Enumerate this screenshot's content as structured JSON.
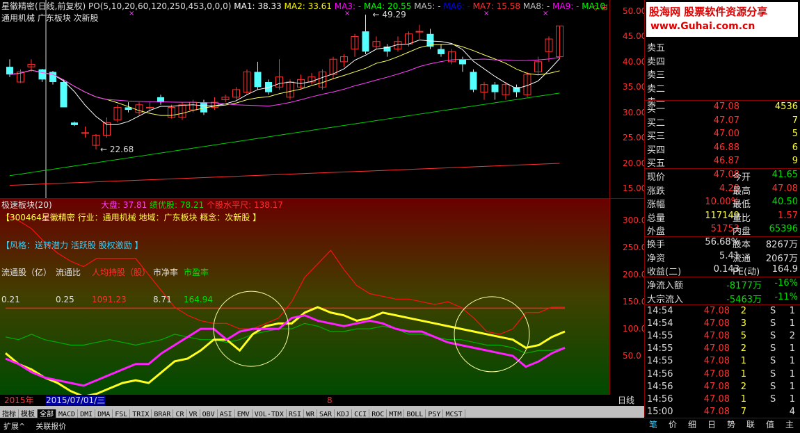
{
  "header": {
    "title": "星徽精密(日线,前复权)",
    "po": "PO(5,10,20,60,120,250,453,0,0,0)",
    "ma": [
      {
        "label": "MA1: 38.33",
        "color": "#ffffff"
      },
      {
        "label": "MA2: 33.61",
        "color": "#ffff00"
      },
      {
        "label": "MA3: -",
        "color": "#ff00ff"
      },
      {
        "label": "MA4: 20.55",
        "color": "#00ff00"
      },
      {
        "label": "MA5: -",
        "color": "#c0c0c0"
      },
      {
        "label": "MA6: -",
        "color": "#0000ff"
      },
      {
        "label": "MA7: 15.58",
        "color": "#ff3030"
      },
      {
        "label": "MA8: -",
        "color": "#c0c0c0"
      },
      {
        "label": "MA9: -",
        "color": "#ff00ff"
      },
      {
        "label": "MA10: -",
        "color": "#00ff00"
      }
    ],
    "subtitle": "通用机械 广东板块 次新股"
  },
  "main_chart": {
    "price_axis": [
      "50.00",
      "45.00",
      "40.00",
      "35.00",
      "30.00",
      "25.00",
      "20.00",
      "15.00"
    ],
    "high_label": "49.29",
    "low_label": "22.68",
    "candles": [
      {
        "o": 39.0,
        "c": 37.5,
        "h": 40.5,
        "l": 37.0
      },
      {
        "o": 36.0,
        "c": 38.0,
        "h": 38.5,
        "l": 35.8
      },
      {
        "o": 39.0,
        "c": 39.5,
        "h": 40.5,
        "l": 38.0
      },
      {
        "o": 38.5,
        "c": 36.5,
        "h": 38.6,
        "l": 36.0
      },
      {
        "o": 38.0,
        "c": 36.0,
        "h": 38.2,
        "l": 35.5
      },
      {
        "o": 36.0,
        "c": 31.0,
        "h": 36.5,
        "l": 31.0
      },
      {
        "o": 28.0,
        "c": 27.5,
        "h": 28.2,
        "l": 27.3
      },
      {
        "o": 26.0,
        "c": 26.0,
        "h": 27.2,
        "l": 25.0
      },
      {
        "o": 23.5,
        "c": 25.5,
        "h": 25.7,
        "l": 22.68
      },
      {
        "o": 25.5,
        "c": 28.0,
        "h": 29.0,
        "l": 25.0
      },
      {
        "o": 28.5,
        "c": 31.0,
        "h": 31.5,
        "l": 28.0
      },
      {
        "o": 31.0,
        "c": 30.5,
        "h": 32.0,
        "l": 30.0
      },
      {
        "o": 30.0,
        "c": 31.5,
        "h": 32.0,
        "l": 29.5
      },
      {
        "o": 31.0,
        "c": 31.0,
        "h": 32.0,
        "l": 30.0
      },
      {
        "o": 33.0,
        "c": 32.0,
        "h": 33.5,
        "l": 31.5
      },
      {
        "o": 29.0,
        "c": 31.0,
        "h": 31.5,
        "l": 28.8
      },
      {
        "o": 29.0,
        "c": 31.5,
        "h": 32.0,
        "l": 28.5
      },
      {
        "o": 30.5,
        "c": 32.0,
        "h": 32.5,
        "l": 30.0
      },
      {
        "o": 32.0,
        "c": 30.0,
        "h": 32.5,
        "l": 29.5
      },
      {
        "o": 31.0,
        "c": 32.0,
        "h": 33.0,
        "l": 30.5
      },
      {
        "o": 32.5,
        "c": 33.0,
        "h": 33.5,
        "l": 32.0
      },
      {
        "o": 33.0,
        "c": 34.5,
        "h": 35.0,
        "l": 32.5
      },
      {
        "o": 34.0,
        "c": 38.0,
        "h": 38.5,
        "l": 33.5
      },
      {
        "o": 38.0,
        "c": 35.0,
        "h": 40.0,
        "l": 34.5
      },
      {
        "o": 36.0,
        "c": 34.0,
        "h": 36.5,
        "l": 33.5
      },
      {
        "o": 35.0,
        "c": 37.0,
        "h": 40.5,
        "l": 34.5
      },
      {
        "o": 33.0,
        "c": 36.0,
        "h": 36.5,
        "l": 32.5
      },
      {
        "o": 35.0,
        "c": 36.5,
        "h": 37.5,
        "l": 34.5
      },
      {
        "o": 36.0,
        "c": 37.0,
        "h": 37.8,
        "l": 35.5
      },
      {
        "o": 35.0,
        "c": 38.0,
        "h": 38.5,
        "l": 34.5
      },
      {
        "o": 37.5,
        "c": 40.5,
        "h": 41.0,
        "l": 36.5
      },
      {
        "o": 40.0,
        "c": 41.0,
        "h": 41.5,
        "l": 39.0
      },
      {
        "o": 42.5,
        "c": 45.0,
        "h": 45.5,
        "l": 41.0
      },
      {
        "o": 46.0,
        "c": 42.0,
        "h": 49.29,
        "l": 41.5
      },
      {
        "o": 43.0,
        "c": 44.0,
        "h": 45.0,
        "l": 42.5
      },
      {
        "o": 43.0,
        "c": 42.0,
        "h": 43.5,
        "l": 41.0
      },
      {
        "o": 42.5,
        "c": 44.0,
        "h": 45.0,
        "l": 42.0
      },
      {
        "o": 43.5,
        "c": 45.5,
        "h": 46.0,
        "l": 43.0
      },
      {
        "o": 46.0,
        "c": 46.0,
        "h": 47.3,
        "l": 44.5
      },
      {
        "o": 45.5,
        "c": 43.0,
        "h": 46.5,
        "l": 42.5
      },
      {
        "o": 42.5,
        "c": 41.5,
        "h": 43.5,
        "l": 41.0
      },
      {
        "o": 40.0,
        "c": 42.0,
        "h": 42.5,
        "l": 39.5
      },
      {
        "o": 40.5,
        "c": 39.5,
        "h": 41.0,
        "l": 38.0
      },
      {
        "o": 38.0,
        "c": 34.5,
        "h": 38.5,
        "l": 34.0
      },
      {
        "o": 34.0,
        "c": 35.5,
        "h": 36.0,
        "l": 32.5
      },
      {
        "o": 35.5,
        "c": 34.0,
        "h": 36.0,
        "l": 32.5
      },
      {
        "o": 33.5,
        "c": 35.5,
        "h": 36.0,
        "l": 32.5
      },
      {
        "o": 35.0,
        "c": 34.0,
        "h": 35.5,
        "l": 33.0
      },
      {
        "o": 33.5,
        "c": 37.5,
        "h": 38.0,
        "l": 33.0
      },
      {
        "o": 38.0,
        "c": 40.0,
        "h": 41.0,
        "l": 37.5
      },
      {
        "o": 42.0,
        "c": 44.5,
        "h": 45.0,
        "l": 40.0
      },
      {
        "o": 41.0,
        "c": 47.08,
        "h": 47.08,
        "l": 40.5
      }
    ]
  },
  "indicator": {
    "title": "极速板块(20)",
    "dapan": "大盘: 37.81",
    "jiyou": "绩优股: 78.21",
    "gegu": "个股水平尺: 138.17",
    "stock_line": "【300464星徽精密 行业：通用机械 地域：广东板块 概念：次新股 】",
    "style_line": "【风格：送转潜力 活跃股 股权激励 】",
    "cols": [
      "流通股（亿）",
      "流通比",
      "人均持股（股）",
      "市净率",
      "市盈率"
    ],
    "vals": [
      "0.21",
      "0.25",
      "1091.23",
      "8.71",
      "164.94"
    ],
    "axis": [
      "300.0",
      "250.0",
      "200.0",
      "150.0",
      "100.0",
      "50.0"
    ],
    "red": [
      310,
      300,
      285,
      260,
      240,
      225,
      215,
      230,
      230,
      230,
      230,
      200,
      170,
      140,
      125,
      115,
      110,
      110,
      100,
      100,
      110,
      120,
      150,
      195,
      220,
      245,
      210,
      180,
      165,
      160,
      155,
      155,
      150,
      145,
      150,
      140,
      120,
      95,
      90,
      100,
      130,
      130,
      140,
      140
    ],
    "yellow": [
      55,
      35,
      25,
      10,
      0,
      -15,
      -25,
      -20,
      -10,
      0,
      5,
      0,
      20,
      40,
      45,
      60,
      80,
      80,
      60,
      90,
      105,
      110,
      110,
      130,
      140,
      130,
      125,
      115,
      120,
      130,
      125,
      120,
      115,
      110,
      105,
      100,
      95,
      90,
      85,
      80,
      65,
      70,
      85,
      95
    ],
    "magenta": [
      45,
      35,
      20,
      10,
      5,
      0,
      -5,
      5,
      15,
      25,
      35,
      35,
      55,
      70,
      85,
      100,
      100,
      80,
      95,
      100,
      100,
      100,
      120,
      125,
      115,
      110,
      105,
      110,
      115,
      110,
      100,
      95,
      95,
      85,
      75,
      70,
      65,
      60,
      55,
      50,
      30,
      40,
      55,
      65
    ],
    "green": [
      85,
      80,
      90,
      80,
      75,
      70,
      70,
      75,
      80,
      75,
      70,
      75,
      80,
      90,
      85,
      80,
      80,
      75,
      80,
      90,
      95,
      100,
      100,
      110,
      105,
      95,
      95,
      100,
      100,
      105,
      100,
      90,
      90,
      85,
      80,
      80,
      75,
      70,
      70,
      65,
      55,
      60,
      60,
      65
    ],
    "hline": 138.17
  },
  "bottom_bar": {
    "year": "2015年",
    "date": "2015/07/01/三",
    "month": "8",
    "period": "日线"
  },
  "tabs": [
    "指标",
    "模板",
    "全部",
    "MACD",
    "DMI",
    "DMA",
    "FSL",
    "TRIX",
    "BRAR",
    "CR",
    "VR",
    "OBV",
    "ASI",
    "EMV",
    "VOL-TDX",
    "RSI",
    "WR",
    "SAR",
    "KDJ",
    "CCI",
    "ROC",
    "MTM",
    "BOLL",
    "PSY",
    "MCST"
  ],
  "footer": [
    "扩展^",
    "关联报价"
  ],
  "side": {
    "logo": "股海网 股票软件资源分享",
    "logo_url": "www.Guhai.com.cn",
    "sell_labels": [
      "卖五",
      "卖四",
      "卖三",
      "卖二",
      "卖一"
    ],
    "buy": [
      {
        "l": "买一",
        "p": "47.08",
        "v": "4536"
      },
      {
        "l": "买二",
        "p": "47.07",
        "v": "7"
      },
      {
        "l": "买三",
        "p": "47.00",
        "v": "5"
      },
      {
        "l": "买四",
        "p": "46.88",
        "v": "6"
      },
      {
        "l": "买五",
        "p": "46.87",
        "v": "9"
      }
    ],
    "quote": [
      {
        "a": "现价",
        "b": "47.08",
        "c": "今开",
        "d": "41.65",
        "bc": "#ff3030",
        "dc": "#00e000"
      },
      {
        "a": "涨跌",
        "b": "4.28",
        "c": "最高",
        "d": "47.08",
        "bc": "#ff3030",
        "dc": "#ff3030"
      },
      {
        "a": "涨幅",
        "b": "10.00%",
        "c": "最低",
        "d": "40.50",
        "bc": "#ff3030",
        "dc": "#00e000"
      },
      {
        "a": "总量",
        "b": "117149",
        "c": "量比",
        "d": "1.57",
        "bc": "#ffff40",
        "dc": "#ff3030"
      },
      {
        "a": "外盘",
        "b": "51753",
        "c": "内盘",
        "d": "65396",
        "bc": "#ff3030",
        "dc": "#00e000"
      }
    ],
    "fin": [
      {
        "a": "换手",
        "b": "56.68%",
        "c": "股本",
        "d": "8267万"
      },
      {
        "a": "净资",
        "b": "5.41",
        "c": "流通",
        "d": "2067万"
      },
      {
        "a": "收益(二)",
        "b": "0.143",
        "c": "PE(动)",
        "d": "164.9"
      }
    ],
    "flow": [
      {
        "a": "净流入额",
        "b": "-8177万",
        "c": "-16%"
      },
      {
        "a": "大宗流入",
        "b": "-5463万",
        "c": "-11%"
      }
    ],
    "ticks": [
      {
        "t": "14:54",
        "p": "47.08",
        "v": "2",
        "s": "S",
        "n": "1"
      },
      {
        "t": "14:54",
        "p": "47.08",
        "v": "3",
        "s": "S",
        "n": "1"
      },
      {
        "t": "14:55",
        "p": "47.08",
        "v": "5",
        "s": "S",
        "n": "2"
      },
      {
        "t": "14:55",
        "p": "47.08",
        "v": "2",
        "s": "S",
        "n": "1"
      },
      {
        "t": "14:55",
        "p": "47.08",
        "v": "1",
        "s": "S",
        "n": "1"
      },
      {
        "t": "14:56",
        "p": "47.08",
        "v": "1",
        "s": "S",
        "n": "1"
      },
      {
        "t": "14:56",
        "p": "47.08",
        "v": "2",
        "s": "S",
        "n": "1"
      },
      {
        "t": "14:56",
        "p": "47.08",
        "v": "1",
        "s": "S",
        "n": "1"
      },
      {
        "t": "15:00",
        "p": "47.08",
        "v": "7",
        "s": "",
        "n": "4"
      }
    ],
    "bottom_tabs": [
      "笔",
      "价",
      "细",
      "日",
      "势",
      "联",
      "值",
      "主"
    ]
  }
}
